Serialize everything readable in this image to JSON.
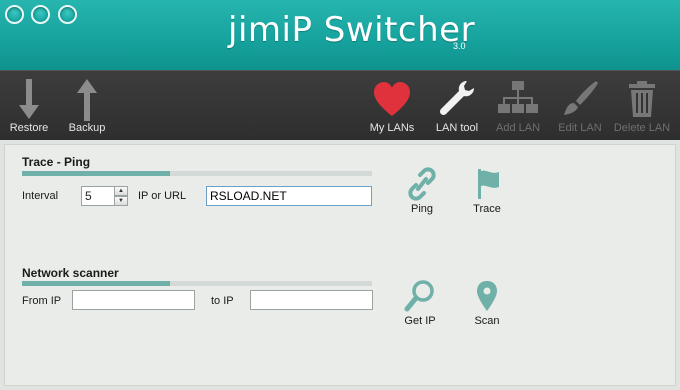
{
  "app": {
    "title": "jimiP Switcher",
    "version": "3.0"
  },
  "toolbar": {
    "restore": "Restore",
    "backup": "Backup",
    "my_lans": "My LANs",
    "lan_tool": "LAN tool",
    "add_lan": "Add LAN",
    "edit_lan": "Edit LAN",
    "delete_lan": "Delete LAN"
  },
  "trace_ping": {
    "title": "Trace - Ping",
    "interval_label": "Interval",
    "interval_value": "5",
    "ip_or_url_label": "IP or URL",
    "ip_or_url_value": "RSLOAD.NET",
    "ping_label": "Ping",
    "trace_label": "Trace"
  },
  "network_scanner": {
    "title": "Network scanner",
    "from_ip_label": "From IP",
    "from_ip_value": "",
    "to_ip_label": "to IP",
    "to_ip_value": "",
    "get_ip_label": "Get IP",
    "scan_label": "Scan"
  },
  "colors": {
    "titlebar": "#17a39e",
    "toolbar": "#333333",
    "accent": "#6fb0a8",
    "heart": "#e0323c"
  }
}
